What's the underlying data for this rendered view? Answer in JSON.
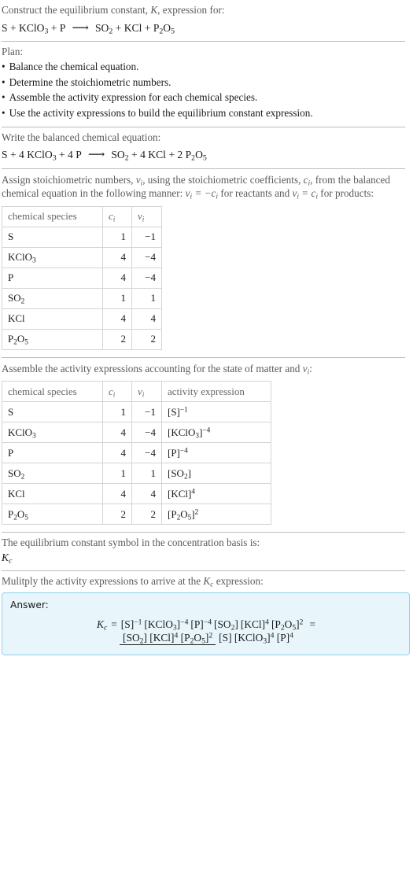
{
  "question": {
    "prompt_pre": "Construct the equilibrium constant, ",
    "prompt_symbol": "K",
    "prompt_post": ", expression for:",
    "equation_plain": "S + KClO3 + P ⟶ SO2 + KCl + P2O5"
  },
  "plan": {
    "heading": "Plan:",
    "items": [
      "Balance the chemical equation.",
      "Determine the stoichiometric numbers.",
      "Assemble the activity expression for each chemical species.",
      "Use the activity expressions to build the equilibrium constant expression."
    ]
  },
  "balanced": {
    "heading": "Write the balanced chemical equation:",
    "equation_plain": "S + 4 KClO3 + 4 P ⟶ SO2 + 4 KCl + 2 P2O5"
  },
  "stoich": {
    "paragraph_1": "Assign stoichiometric numbers, ",
    "paragraph_2": ", using the stoichiometric coefficients, ",
    "paragraph_3": ", from the balanced chemical equation in the following manner: ",
    "paragraph_4": " for reactants and ",
    "paragraph_5": " for products:",
    "nu_i": "νi",
    "c_i": "ci",
    "rule_reactants": "νi = −ci",
    "rule_products": "νi = ci",
    "columns": [
      "chemical species",
      "ci",
      "νi"
    ],
    "rows": [
      {
        "species_plain": "S",
        "c": "1",
        "v": "−1"
      },
      {
        "species_plain": "KClO3",
        "c": "4",
        "v": "−4"
      },
      {
        "species_plain": "P",
        "c": "4",
        "v": "−4"
      },
      {
        "species_plain": "SO2",
        "c": "1",
        "v": "1"
      },
      {
        "species_plain": "KCl",
        "c": "4",
        "v": "4"
      },
      {
        "species_plain": "P2O5",
        "c": "2",
        "v": "2"
      }
    ]
  },
  "activity": {
    "heading_pre": "Assemble the activity expressions accounting for the state of matter and ",
    "heading_post": ":",
    "columns": [
      "chemical species",
      "ci",
      "νi",
      "activity expression"
    ],
    "rows": [
      {
        "species_plain": "S",
        "c": "1",
        "v": "−1",
        "expr_plain": "[S]^-1"
      },
      {
        "species_plain": "KClO3",
        "c": "4",
        "v": "−4",
        "expr_plain": "[KClO3]^-4"
      },
      {
        "species_plain": "P",
        "c": "4",
        "v": "−4",
        "expr_plain": "[P]^-4"
      },
      {
        "species_plain": "SO2",
        "c": "1",
        "v": "1",
        "expr_plain": "[SO2]"
      },
      {
        "species_plain": "KCl",
        "c": "4",
        "v": "4",
        "expr_plain": "[KCl]^4"
      },
      {
        "species_plain": "P2O5",
        "c": "2",
        "v": "2",
        "expr_plain": "[P2O5]^2"
      }
    ]
  },
  "ksymbol": {
    "heading": "The equilibrium constant symbol in the concentration basis is:",
    "symbol_plain": "Kc"
  },
  "multiply": {
    "heading_pre": "Mulitply the activity expressions to arrive at the ",
    "heading_symbol": "Kc",
    "heading_post": " expression:"
  },
  "answer": {
    "label": "Answer:",
    "lhs_plain": "Kc",
    "expression_plain": "Kc = [S]^-1 [KClO3]^-4 [P]^-4 [SO2] [KCl]^4 [P2O5]^2 = ([SO2] [KCl]^4 [P2O5]^2) / ([S] [KClO3]^4 [P]^4)",
    "numerator_plain": "[SO2] [KCl]^4 [P2O5]^2",
    "denominator_plain": "[S] [KClO3]^4 [P]^4"
  },
  "colors": {
    "answer_bg": "#e8f6fb",
    "answer_border": "#8fd3e8",
    "rule": "#bcbcbc",
    "table_border": "#d4d4d4",
    "muted_text": "#5a5a5a"
  }
}
